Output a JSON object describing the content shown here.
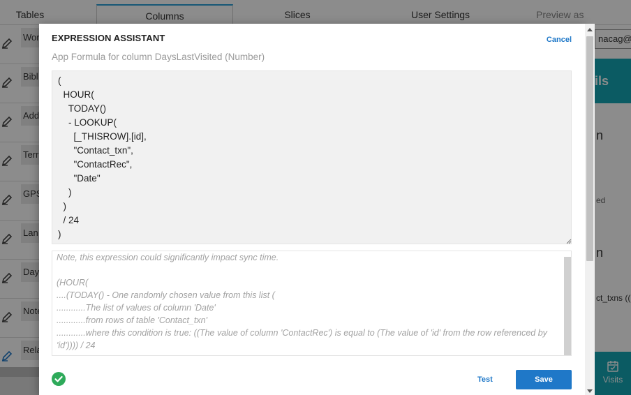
{
  "background": {
    "tabs": [
      "Tables",
      "Columns",
      "Slices",
      "User Settings",
      "Preview as"
    ],
    "rows": [
      "Wor",
      "Bibl",
      "Add",
      "Terr",
      "GPS",
      "Lan",
      "Day",
      "Note",
      "Rela"
    ],
    "right_panel": {
      "email": "nacag@g",
      "header_fragment": "ils",
      "texts": [
        "n",
        "ed",
        "n",
        "ct_txns (("
      ],
      "visits_label": "Visits"
    }
  },
  "modal": {
    "title": "EXPRESSION ASSISTANT",
    "cancel_label": "Cancel",
    "subtitle": "App Formula for column DaysLastVisited (Number)",
    "expression": "(\n  HOUR(\n    TODAY()\n    - LOOKUP(\n      [_THISROW].[id],\n      \"Contact_txn\",\n      \"ContactRec\",\n      \"Date\"\n    )\n  )\n  / 24\n)",
    "preview_lines": [
      "Note, this expression could significantly impact sync time.",
      "",
      "(HOUR(",
      "....(TODAY() - One randomly chosen value from this list (",
      "............The list of values of column 'Date'",
      "............from rows of table 'Contact_txn'",
      "............where this condition is true: ((The value of column 'ContactRec') is equal to (The value of 'id' from the row referenced by 'id')))) / 24"
    ],
    "test_label": "Test",
    "save_label": "Save",
    "status_icon": "check-circle-icon",
    "colors": {
      "accent": "#1f78c8",
      "success": "#2eaa5a",
      "teal": "#14a6b4"
    }
  }
}
